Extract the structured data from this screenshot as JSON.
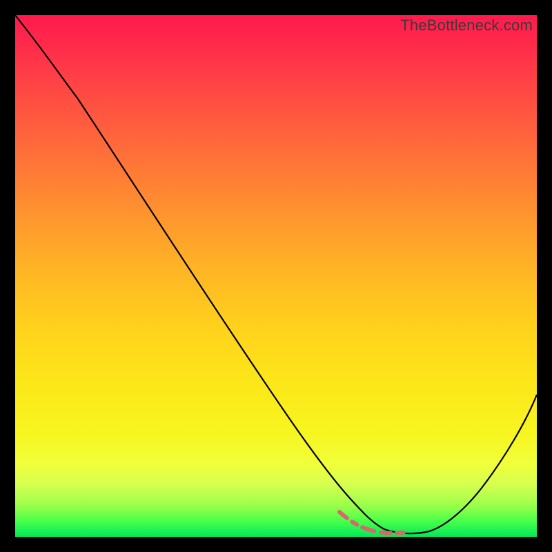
{
  "watermark": "TheBottleneck.com",
  "chart_data": {
    "type": "line",
    "title": "",
    "xlabel": "",
    "ylabel": "",
    "legend": false,
    "grid": false,
    "xlim": [
      0,
      100
    ],
    "ylim": [
      0,
      100
    ],
    "x": [
      0,
      5,
      10,
      15,
      20,
      25,
      30,
      35,
      40,
      45,
      50,
      55,
      60,
      62,
      65,
      68,
      70,
      72,
      75,
      78,
      80,
      85,
      90,
      95,
      100
    ],
    "values": [
      100,
      96,
      90,
      83,
      76,
      68,
      60,
      52,
      44,
      36,
      28,
      20,
      12,
      9,
      5,
      2.5,
      1.2,
      0.6,
      0.3,
      0.5,
      1.2,
      4,
      10,
      18,
      28
    ],
    "dashed_segment_x": [
      62,
      80
    ],
    "colors": {
      "curve": "#000000",
      "dashed": "#d46a6a",
      "gradient_top": "#ff1a4d",
      "gradient_bottom": "#00e85a",
      "background": "#000000"
    }
  }
}
